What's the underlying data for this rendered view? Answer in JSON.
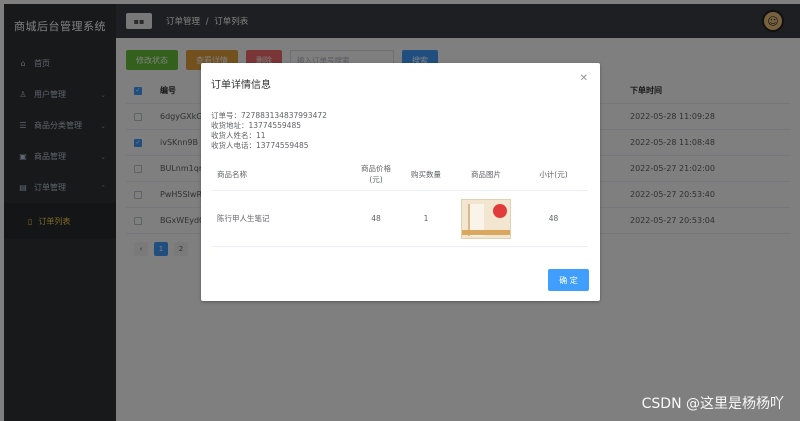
{
  "app": {
    "title": "商城后台管理系统"
  },
  "sidebar": {
    "items": [
      {
        "label": "首页",
        "icon": "home-icon"
      },
      {
        "label": "用户管理",
        "icon": "user-icon"
      },
      {
        "label": "商品分类管理",
        "icon": "list-icon"
      },
      {
        "label": "商品管理",
        "icon": "shop-icon"
      },
      {
        "label": "订单管理",
        "icon": "order-icon"
      }
    ],
    "sub_item": {
      "label": "订单列表",
      "icon": "document-icon"
    }
  },
  "header": {
    "crumb_parent": "订单管理",
    "crumb_sep": "/",
    "crumb_current": "订单列表"
  },
  "toolbar": {
    "edit_status": "修改状态",
    "view_detail": "查看详情",
    "delete": "删除",
    "search_placeholder": "输入订单号搜索",
    "search": "搜索"
  },
  "table": {
    "headers": {
      "id": "编号",
      "time": "下单时间"
    },
    "rows": [
      {
        "id": "6dgyGXkG",
        "time": "2022-05-28 11:09:28",
        "checked": false
      },
      {
        "id": "ivSKnn9B",
        "time": "2022-05-28 11:08:48",
        "checked": true
      },
      {
        "id": "BULnm1qr",
        "time": "2022-05-27 21:02:00",
        "checked": false
      },
      {
        "id": "PwH5SIwR",
        "time": "2022-05-27 20:53:40",
        "checked": false
      },
      {
        "id": "BGxWEydC",
        "time": "2022-05-27 20:53:04",
        "checked": false
      }
    ]
  },
  "pager": {
    "pages": [
      "‹",
      "1",
      "2"
    ]
  },
  "dialog": {
    "title": "订单详情信息",
    "info": {
      "order_no": "订单号：727883134837993472",
      "address": "收货地址：13774559485",
      "name": "收货人姓名：11",
      "phone": "收货人电话：13774559485"
    },
    "columns": {
      "name": "商品名称",
      "price_1": "商品价格",
      "price_2": "(元)",
      "qty": "购买数量",
      "img": "商品图片",
      "sub": "小计(元)"
    },
    "row": {
      "name": "陈行甲人生笔记",
      "price": "48",
      "qty": "1",
      "sub": "48"
    },
    "confirm": "确 定"
  },
  "watermark": "CSDN @这里是杨杨吖"
}
